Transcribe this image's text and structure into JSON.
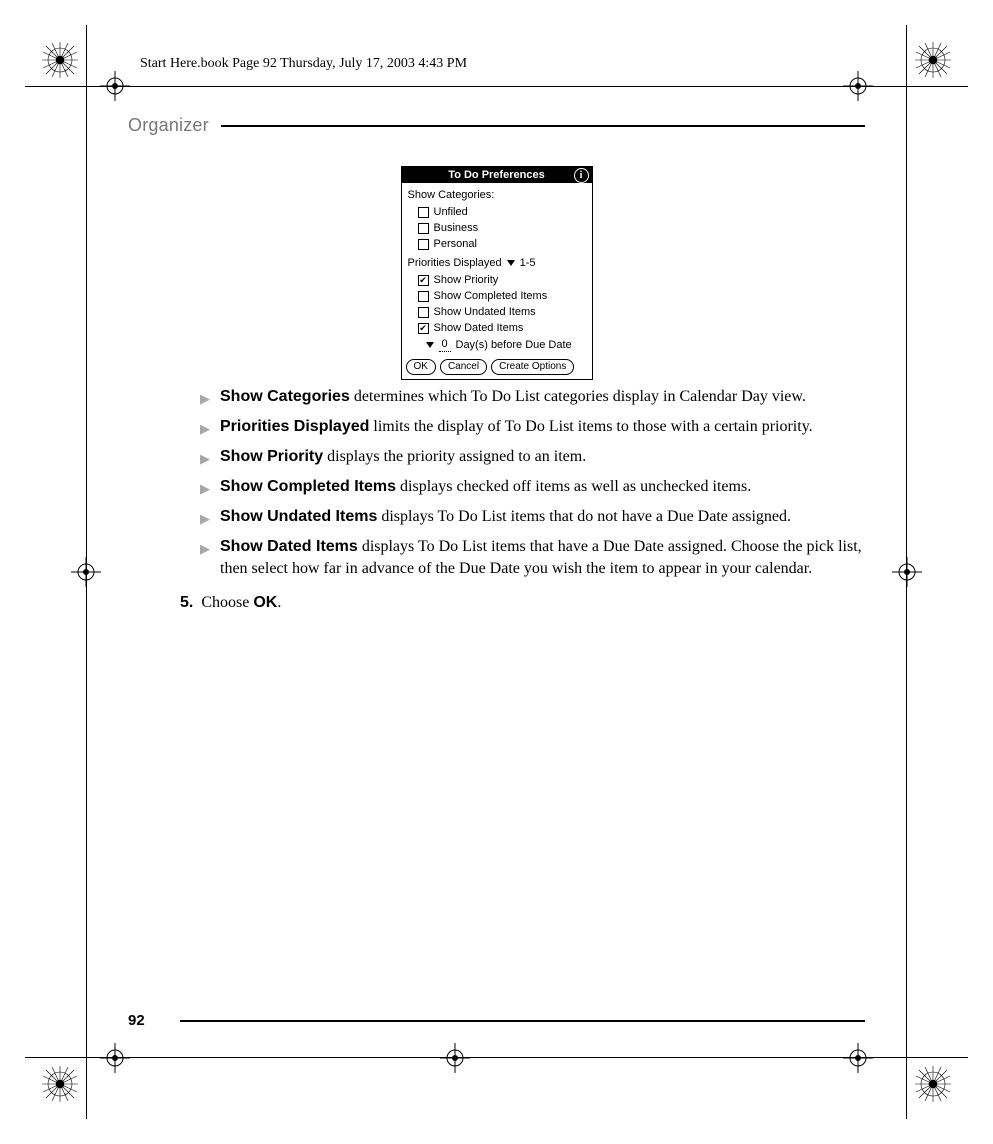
{
  "header_line": "Start Here.book  Page 92  Thursday, July 17, 2003  4:43 PM",
  "section_title": "Organizer",
  "page_number": "92",
  "palm": {
    "title": "To Do Preferences",
    "show_categories_label": "Show Categories:",
    "categories": [
      "Unfiled",
      "Business",
      "Personal"
    ],
    "priorities_label": "Priorities Displayed",
    "priorities_value": "1-5",
    "opts": [
      {
        "label": "Show Priority",
        "checked": true
      },
      {
        "label": "Show Completed Items",
        "checked": false
      },
      {
        "label": "Show Undated Items",
        "checked": false
      },
      {
        "label": "Show Dated Items",
        "checked": true
      }
    ],
    "days_value": "0",
    "days_suffix": "Day(s) before Due Date",
    "buttons": {
      "ok": "OK",
      "cancel": "Cancel",
      "create": "Create Options"
    }
  },
  "bullets": [
    {
      "term": "Show Categories",
      "text": " determines which To Do List categories display in Calendar Day view."
    },
    {
      "term": "Priorities Displayed",
      "text": " limits the display of To Do List items to those with a certain priority."
    },
    {
      "term": "Show Priority",
      "text": " displays the priority assigned to an item."
    },
    {
      "term": "Show Completed Items",
      "text": " displays checked off items as well as unchecked items."
    },
    {
      "term": "Show Undated Items",
      "text": " displays To Do List items that do not have a Due Date assigned."
    },
    {
      "term": "Show Dated Items",
      "text": " displays To Do List items that have a Due Date assigned. Choose the pick list, then select how far in advance of the Due Date you wish the item to appear in your calendar."
    }
  ],
  "step": {
    "num": "5.",
    "pre": "Choose ",
    "bold": "OK",
    "post": "."
  }
}
